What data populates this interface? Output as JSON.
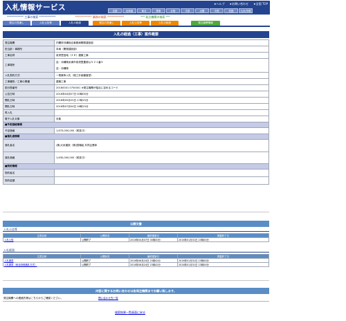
{
  "header": {
    "logo": "入札情報サービス",
    "utilities": [
      "★ヘルプ",
      "★お問い合わせ",
      "★全国 TOP"
    ],
    "regions": [
      "全国",
      "北海道",
      "東北",
      "関東",
      "北陸",
      "中部",
      "近畿",
      "中国",
      "四国",
      "九州/沖縄"
    ]
  },
  "search_row": {
    "construction": "************  工事の検索  ************",
    "services": "************  業務の検索  ************",
    "agency": "***  発注機関の検索  ***"
  },
  "tabs": {
    "items": [
      {
        "label": "発注の見通し",
        "color": "#5a79c6"
      },
      {
        "label": "入札公告等",
        "color": "#5a79c6"
      },
      {
        "label": "入札の経過",
        "color": "#24448f"
      },
      {
        "label": "発注の見通し",
        "color": "#ee8800"
      },
      {
        "label": "入札公告等",
        "color": "#ee8800"
      },
      {
        "label": "入札の経過",
        "color": "#ee8800"
      },
      {
        "label": "発注機関情報",
        "color": "#4faa3a"
      }
    ]
  },
  "main_title": "入札の経過（工事）案件概要",
  "details": [
    {
      "label": "発注機関",
      "value": "内閣府沖縄総合事務局開発建設部"
    },
    {
      "label": "担当部・事務所",
      "value": "本局（開発建設部）"
    },
    {
      "label": "工事名称",
      "value": "真栄里団地（２８）建築工事"
    },
    {
      "label": "工事場所",
      "value": "自：沖縄県糸満市真栄里豊原以５２１番５",
      "value2": "至：沖縄県"
    },
    {
      "label": "入札契約方式",
      "value": "一般競争入札（施工計画審査型）"
    },
    {
      "label": "工事種別／工事の業種",
      "value": "建築工事"
    },
    {
      "label": "設計書番号",
      "value": "20160001 0750001        ※発注機関が独自に定めるコード"
    },
    {
      "label": "公告日時",
      "value": "2016年04月07日 00時00分"
    },
    {
      "label": "開札日時",
      "value": "2016年05月25日 17時15分"
    },
    {
      "label": "開札日時",
      "value": "2016年07月04日 16時15分"
    },
    {
      "label": "再入札",
      "value": ""
    },
    {
      "label": "電子入札対象",
      "value": "対象"
    }
  ],
  "sections": {
    "estimate": "■予定価格情報",
    "estimate_label": "予定価格",
    "estimate_value": "1,670,000,000（税抜き）",
    "winner": "■落札者情報",
    "winner_name_label": "落札者名",
    "winner_name": "(株)大米建設（株)国場組 共同企業体",
    "winner_price_label": "落札価格",
    "winner_price": "1,630,000,000（税抜き）",
    "contract": "■契約情報",
    "contractor_label": "契約者名",
    "contract_amount_label": "契約金額"
  },
  "public_docs": {
    "title": "公開文書",
    "bid_notice": {
      "heading": "入札公告等",
      "columns": [
        "文書名称",
        "公開状況",
        "最終更新日",
        "掲載終了日"
      ],
      "rows": [
        [
          "入札公告",
          "公開終了",
          "2016年04月07日 00時00分",
          "2016年01月31日 23時00分"
        ]
      ]
    },
    "bid_progress": {
      "heading": "入札経過",
      "columns": [
        "文書名称",
        "公開状況",
        "最終更新日",
        "掲載終了日"
      ],
      "rows": [
        [
          "入札調書",
          "公開終了",
          "2016年06月24日 23時42分",
          "2016年01月31日 23時00分"
        ],
        [
          "入札調書（総合評価落札方式）",
          "公開終了",
          "2016年06月24日 23時42分",
          "2016年01月31日 23時00分"
        ]
      ]
    }
  },
  "contact": {
    "bar": "内容に関するお問い合わせは各発注機関までお願い致します。",
    "text": "発注機関への連絡先等はこちらからご確認ください。",
    "link": "問い合わせ先一覧"
  },
  "back_link": "検索結果一覧画面に戻る"
}
